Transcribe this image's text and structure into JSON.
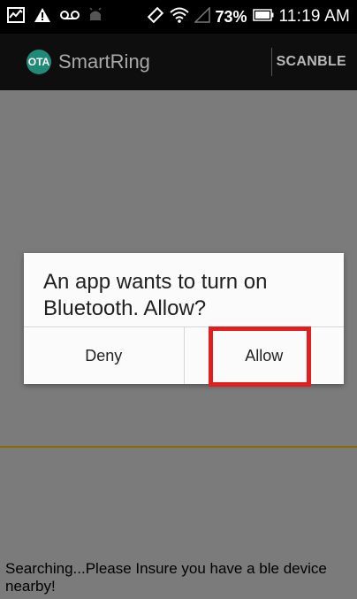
{
  "status_bar": {
    "battery_percent": "73%",
    "time": "11:19 AM",
    "icons": [
      "activity-icon",
      "warning-icon",
      "voicemail-icon",
      "android-debug-icon",
      "rotate-icon",
      "wifi-icon",
      "signal-icon",
      "battery-icon"
    ]
  },
  "app_bar": {
    "logo_text": "OTA",
    "title": "SmartRing",
    "action_label": "SCANBLE"
  },
  "dialog": {
    "message": "An app wants to turn on Bluetooth. Allow?",
    "deny_label": "Deny",
    "allow_label": "Allow"
  },
  "footer": {
    "message": "Searching...Please Insure you have a ble device nearby!"
  },
  "colors": {
    "accent_highlight": "#e31e1e",
    "logo_bg": "#1f8a77",
    "divider_line": "#8a6b00"
  }
}
